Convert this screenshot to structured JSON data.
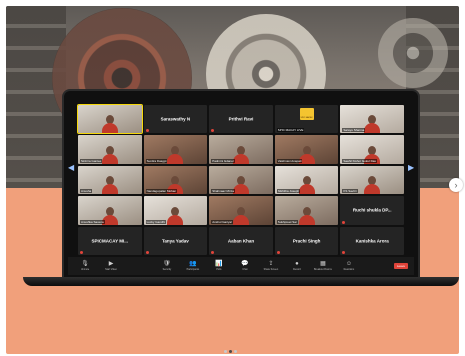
{
  "carousel": {
    "next_glyph": "›"
  },
  "meeting": {
    "pager": {
      "prev_glyph": "◀",
      "next_glyph": "▶"
    },
    "tiles": [
      {
        "kind": "video",
        "name": "",
        "style": "v2",
        "speaking": true
      },
      {
        "kind": "label",
        "label": "Saraswathy N"
      },
      {
        "kind": "label",
        "label": "Prithvi Ravi"
      },
      {
        "kind": "logo",
        "name": "SPIC MACAY LIVE",
        "logo_text": "SPIC MACAY"
      },
      {
        "kind": "video",
        "name": "Sarayu Sharma",
        "style": "v4"
      },
      {
        "kind": "video",
        "name": "Sinbrra Gantee",
        "style": "v2"
      },
      {
        "kind": "video",
        "name": "Sunitra Dasgpt",
        "style": "v3"
      },
      {
        "kind": "video",
        "name": "Padmini Gdaner",
        "style": "v1"
      },
      {
        "kind": "video",
        "name": "Vaishnavi Anapati",
        "style": "v3"
      },
      {
        "kind": "video",
        "name": "Saahil Kishor Gokul Das",
        "style": "v4"
      },
      {
        "kind": "video",
        "name": "Anusha",
        "style": "v2"
      },
      {
        "kind": "video",
        "name": "Nandagopalan Mohan",
        "style": "v3"
      },
      {
        "kind": "video",
        "name": "Shahnaaz Mirza",
        "style": "v1"
      },
      {
        "kind": "video",
        "name": "Nikhitha Joseph",
        "style": "v4"
      },
      {
        "kind": "video",
        "name": "KS Savitri",
        "style": "v2"
      },
      {
        "kind": "video",
        "name": "Anushka Saxena",
        "style": "v2"
      },
      {
        "kind": "video",
        "name": "Lucky Gandhi",
        "style": "v4"
      },
      {
        "kind": "video",
        "name": "Anshul Gariyal",
        "style": "v3"
      },
      {
        "kind": "video",
        "name": "Sukhpreet Sai",
        "style": "v1"
      },
      {
        "kind": "label",
        "label": "Ruchi shukla DP..."
      },
      {
        "kind": "label",
        "label": "SPICMACAY MI..."
      },
      {
        "kind": "label",
        "label": "Tanya Yadav"
      },
      {
        "kind": "label",
        "label": "Aaban Khan"
      },
      {
        "kind": "label",
        "label": "Prachi Singh"
      },
      {
        "kind": "label",
        "label": "Kanishka Arora"
      }
    ],
    "toolbar": {
      "items": [
        {
          "icon": "mic-icon",
          "glyph": "🎙",
          "label": "Unmute"
        },
        {
          "icon": "video-icon",
          "glyph": "▶",
          "label": "Start Video"
        },
        {
          "icon": "security-icon",
          "glyph": "🛡",
          "label": "Security"
        },
        {
          "icon": "participants-icon",
          "glyph": "👥",
          "label": "Participants"
        },
        {
          "icon": "polls-icon",
          "glyph": "📊",
          "label": "Polls"
        },
        {
          "icon": "chat-icon",
          "glyph": "💬",
          "label": "Chat"
        },
        {
          "icon": "share-screen-icon",
          "glyph": "⇪",
          "label": "Share Screen"
        },
        {
          "icon": "record-icon",
          "glyph": "●",
          "label": "Record"
        },
        {
          "icon": "breakout-icon",
          "glyph": "▦",
          "label": "Breakout Rooms"
        },
        {
          "icon": "reactions-icon",
          "glyph": "☺",
          "label": "Reactions"
        }
      ],
      "end_label": "Leave"
    }
  },
  "colors": {
    "accent_salmon": "#f1a07b",
    "end_red": "#e0443a",
    "speaking_yellow": "#f5d70a"
  }
}
